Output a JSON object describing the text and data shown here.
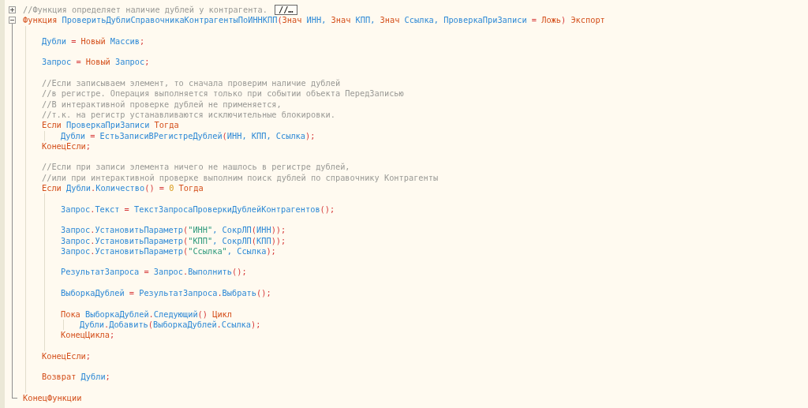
{
  "blocks": [
    {
      "collapsed": true,
      "fold_hint": "//…",
      "lines": [
        {
          "kind": "code",
          "tokens": [
            {
              "kind": "comment",
              "text": "//Функция определяет наличие дублей у контрагента."
            }
          ]
        }
      ]
    },
    {
      "collapsed": false,
      "lines": [
        {
          "kind": "code",
          "tokens": [
            {
              "kind": "keyword",
              "text": "Функция "
            },
            {
              "kind": "ident",
              "text": "ПроверитьДублиСправочникаКонтрагентыПоИННКПП"
            },
            {
              "kind": "op",
              "text": "("
            },
            {
              "kind": "keyword",
              "text": "Знач "
            },
            {
              "kind": "ident",
              "text": "ИНН, "
            },
            {
              "kind": "keyword",
              "text": "Знач "
            },
            {
              "kind": "ident",
              "text": "КПП, "
            },
            {
              "kind": "keyword",
              "text": "Знач "
            },
            {
              "kind": "ident",
              "text": "Ссылка, ПроверкаПриЗаписи "
            },
            {
              "kind": "op",
              "text": "= "
            },
            {
              "kind": "keyword",
              "text": "Ложь"
            },
            {
              "kind": "op",
              "text": ") "
            },
            {
              "kind": "keyword",
              "text": "Экспорт"
            }
          ],
          "children": [
            {
              "kind": "blank"
            },
            {
              "kind": "code",
              "tokens": [
                {
                  "kind": "ident",
                  "text": "Дубли "
                },
                {
                  "kind": "op",
                  "text": "= "
                },
                {
                  "kind": "keyword",
                  "text": "Новый "
                },
                {
                  "kind": "ident",
                  "text": "Массив"
                },
                {
                  "kind": "op",
                  "text": ";"
                }
              ]
            },
            {
              "kind": "blank"
            },
            {
              "kind": "code",
              "tokens": [
                {
                  "kind": "ident",
                  "text": "Запрос "
                },
                {
                  "kind": "op",
                  "text": "= "
                },
                {
                  "kind": "keyword",
                  "text": "Новый "
                },
                {
                  "kind": "ident",
                  "text": "Запрос"
                },
                {
                  "kind": "op",
                  "text": ";"
                }
              ]
            },
            {
              "kind": "blank"
            },
            {
              "kind": "code",
              "tokens": [
                {
                  "kind": "comment",
                  "text": "//Если записываем элемент, то сначала проверим наличие дублей"
                }
              ]
            },
            {
              "kind": "code",
              "tokens": [
                {
                  "kind": "comment",
                  "text": "//в регистре. Операция выполняется только при событии объекта ПередЗаписью"
                }
              ]
            },
            {
              "kind": "code",
              "tokens": [
                {
                  "kind": "comment",
                  "text": "//В интерактивной проверке дублей не применяется,"
                }
              ]
            },
            {
              "kind": "code",
              "tokens": [
                {
                  "kind": "comment",
                  "text": "//т.к. на регистр устанавливаются исключительные блокировки."
                }
              ]
            },
            {
              "kind": "code",
              "tokens": [
                {
                  "kind": "keyword",
                  "text": "Если "
                },
                {
                  "kind": "ident",
                  "text": "ПроверкаПриЗаписи "
                },
                {
                  "kind": "keyword",
                  "text": "Тогда"
                }
              ],
              "children": [
                {
                  "kind": "code",
                  "tokens": [
                    {
                      "kind": "ident",
                      "text": "Дубли "
                    },
                    {
                      "kind": "op",
                      "text": "= "
                    },
                    {
                      "kind": "ident",
                      "text": "ЕстьЗаписиВРегистреДублей"
                    },
                    {
                      "kind": "op",
                      "text": "("
                    },
                    {
                      "kind": "ident",
                      "text": "ИНН, КПП, Ссылка"
                    },
                    {
                      "kind": "op",
                      "text": ");"
                    }
                  ]
                }
              ]
            },
            {
              "kind": "code",
              "tokens": [
                {
                  "kind": "keyword",
                  "text": "КонецЕсли"
                },
                {
                  "kind": "op",
                  "text": ";"
                }
              ]
            },
            {
              "kind": "blank"
            },
            {
              "kind": "code",
              "tokens": [
                {
                  "kind": "comment",
                  "text": "//Если при записи элемента ничего не нашлось в регистре дублей,"
                }
              ]
            },
            {
              "kind": "code",
              "tokens": [
                {
                  "kind": "comment",
                  "text": "//или при интерактивной проверке выполним поиск дублей по справочнику Контрагенты"
                }
              ]
            },
            {
              "kind": "code",
              "tokens": [
                {
                  "kind": "keyword",
                  "text": "Если "
                },
                {
                  "kind": "ident",
                  "text": "Дубли"
                },
                {
                  "kind": "op",
                  "text": "."
                },
                {
                  "kind": "ident",
                  "text": "Количество"
                },
                {
                  "kind": "op",
                  "text": "() = "
                },
                {
                  "kind": "number",
                  "text": "0 "
                },
                {
                  "kind": "keyword",
                  "text": "Тогда"
                }
              ],
              "children": [
                {
                  "kind": "blank"
                },
                {
                  "kind": "code",
                  "tokens": [
                    {
                      "kind": "ident",
                      "text": "Запрос"
                    },
                    {
                      "kind": "op",
                      "text": "."
                    },
                    {
                      "kind": "ident",
                      "text": "Текст "
                    },
                    {
                      "kind": "op",
                      "text": "= "
                    },
                    {
                      "kind": "ident",
                      "text": "ТекстЗапросаПроверкиДублейКонтрагентов"
                    },
                    {
                      "kind": "op",
                      "text": "();"
                    }
                  ]
                },
                {
                  "kind": "blank"
                },
                {
                  "kind": "code",
                  "tokens": [
                    {
                      "kind": "ident",
                      "text": "Запрос"
                    },
                    {
                      "kind": "op",
                      "text": "."
                    },
                    {
                      "kind": "ident",
                      "text": "УстановитьПараметр"
                    },
                    {
                      "kind": "op",
                      "text": "("
                    },
                    {
                      "kind": "string",
                      "text": "\"ИНН\""
                    },
                    {
                      "kind": "ident",
                      "text": ", СокрЛП"
                    },
                    {
                      "kind": "op",
                      "text": "("
                    },
                    {
                      "kind": "ident",
                      "text": "ИНН"
                    },
                    {
                      "kind": "op",
                      "text": "));"
                    }
                  ]
                },
                {
                  "kind": "code",
                  "tokens": [
                    {
                      "kind": "ident",
                      "text": "Запрос"
                    },
                    {
                      "kind": "op",
                      "text": "."
                    },
                    {
                      "kind": "ident",
                      "text": "УстановитьПараметр"
                    },
                    {
                      "kind": "op",
                      "text": "("
                    },
                    {
                      "kind": "string",
                      "text": "\"КПП\""
                    },
                    {
                      "kind": "ident",
                      "text": ", СокрЛП"
                    },
                    {
                      "kind": "op",
                      "text": "("
                    },
                    {
                      "kind": "ident",
                      "text": "КПП"
                    },
                    {
                      "kind": "op",
                      "text": "));"
                    }
                  ]
                },
                {
                  "kind": "code",
                  "tokens": [
                    {
                      "kind": "ident",
                      "text": "Запрос"
                    },
                    {
                      "kind": "op",
                      "text": "."
                    },
                    {
                      "kind": "ident",
                      "text": "УстановитьПараметр"
                    },
                    {
                      "kind": "op",
                      "text": "("
                    },
                    {
                      "kind": "string",
                      "text": "\"Ссылка\""
                    },
                    {
                      "kind": "ident",
                      "text": ", Ссылка"
                    },
                    {
                      "kind": "op",
                      "text": ");"
                    }
                  ]
                },
                {
                  "kind": "blank"
                },
                {
                  "kind": "code",
                  "tokens": [
                    {
                      "kind": "ident",
                      "text": "РезультатЗапроса "
                    },
                    {
                      "kind": "op",
                      "text": "= "
                    },
                    {
                      "kind": "ident",
                      "text": "Запрос"
                    },
                    {
                      "kind": "op",
                      "text": "."
                    },
                    {
                      "kind": "ident",
                      "text": "Выполнить"
                    },
                    {
                      "kind": "op",
                      "text": "();"
                    }
                  ]
                },
                {
                  "kind": "blank"
                },
                {
                  "kind": "code",
                  "tokens": [
                    {
                      "kind": "ident",
                      "text": "ВыборкаДублей "
                    },
                    {
                      "kind": "op",
                      "text": "= "
                    },
                    {
                      "kind": "ident",
                      "text": "РезультатЗапроса"
                    },
                    {
                      "kind": "op",
                      "text": "."
                    },
                    {
                      "kind": "ident",
                      "text": "Выбрать"
                    },
                    {
                      "kind": "op",
                      "text": "();"
                    }
                  ]
                },
                {
                  "kind": "blank"
                },
                {
                  "kind": "code",
                  "tokens": [
                    {
                      "kind": "keyword",
                      "text": "Пока "
                    },
                    {
                      "kind": "ident",
                      "text": "ВыборкаДублей"
                    },
                    {
                      "kind": "op",
                      "text": "."
                    },
                    {
                      "kind": "ident",
                      "text": "Следующий"
                    },
                    {
                      "kind": "op",
                      "text": "() "
                    },
                    {
                      "kind": "keyword",
                      "text": "Цикл"
                    }
                  ],
                  "children": [
                    {
                      "kind": "code",
                      "tokens": [
                        {
                          "kind": "ident",
                          "text": "Дубли"
                        },
                        {
                          "kind": "op",
                          "text": "."
                        },
                        {
                          "kind": "ident",
                          "text": "Добавить"
                        },
                        {
                          "kind": "op",
                          "text": "("
                        },
                        {
                          "kind": "ident",
                          "text": "ВыборкаДублей"
                        },
                        {
                          "kind": "op",
                          "text": "."
                        },
                        {
                          "kind": "ident",
                          "text": "Ссылка"
                        },
                        {
                          "kind": "op",
                          "text": ");"
                        }
                      ]
                    }
                  ]
                },
                {
                  "kind": "code",
                  "tokens": [
                    {
                      "kind": "keyword",
                      "text": "КонецЦикла"
                    },
                    {
                      "kind": "op",
                      "text": ";"
                    }
                  ]
                },
                {
                  "kind": "blank"
                }
              ]
            },
            {
              "kind": "code",
              "tokens": [
                {
                  "kind": "keyword",
                  "text": "КонецЕсли"
                },
                {
                  "kind": "op",
                  "text": ";"
                }
              ]
            },
            {
              "kind": "blank"
            },
            {
              "kind": "code",
              "tokens": [
                {
                  "kind": "keyword",
                  "text": "Возврат "
                },
                {
                  "kind": "ident",
                  "text": "Дубли"
                },
                {
                  "kind": "op",
                  "text": ";"
                }
              ]
            },
            {
              "kind": "blank"
            }
          ]
        },
        {
          "kind": "code",
          "tokens": [
            {
              "kind": "keyword",
              "text": "КонецФункции"
            }
          ]
        }
      ]
    }
  ]
}
